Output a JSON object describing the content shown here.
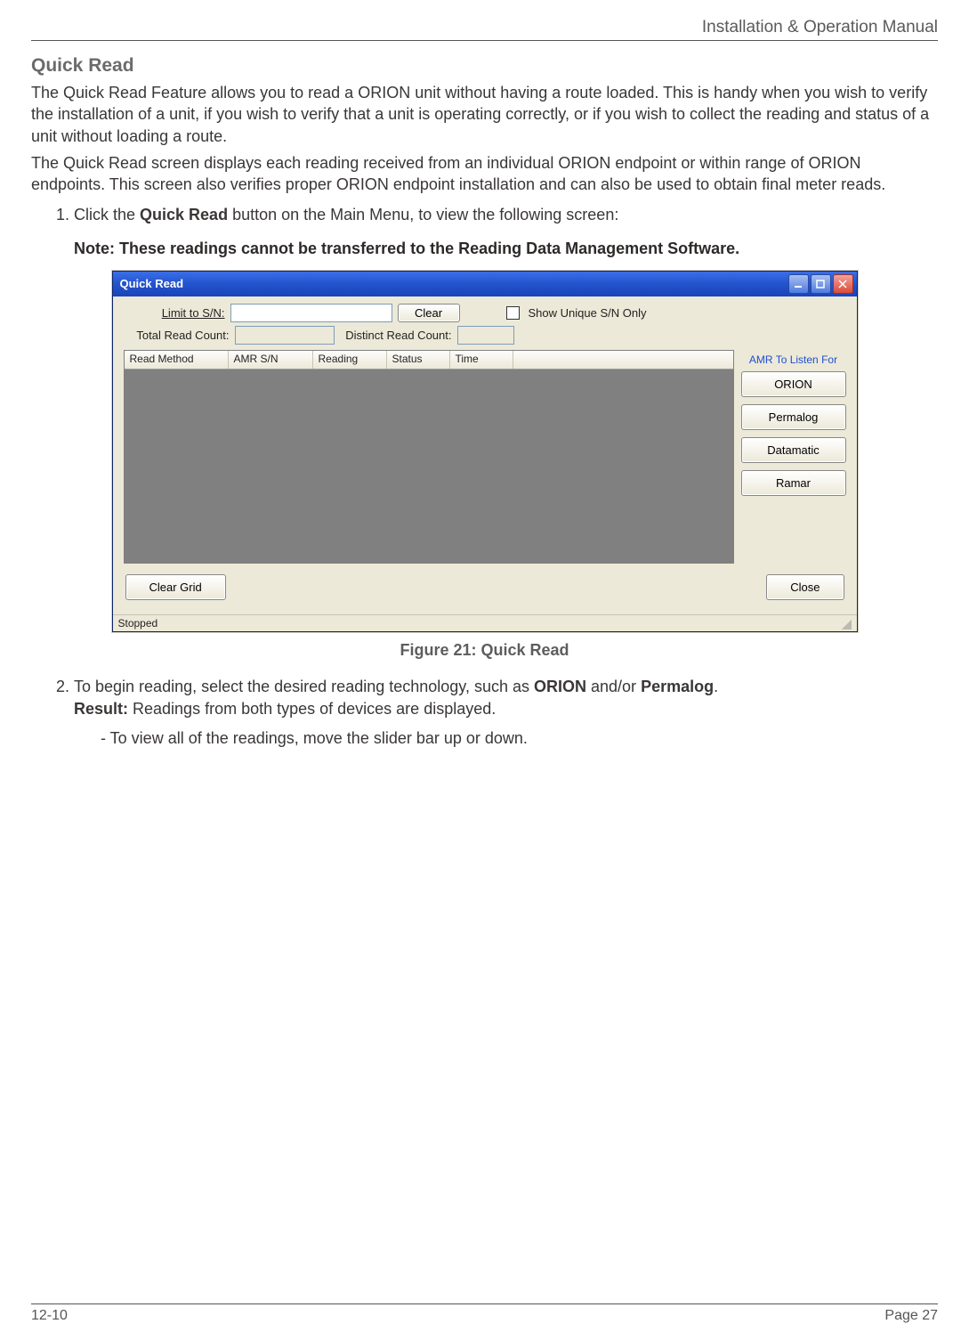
{
  "header": {
    "title": "Installation & Operation Manual"
  },
  "section": {
    "heading": "Quick Read"
  },
  "paragraphs": {
    "p1": "The Quick Read Feature allows you to read a ORION unit without having a route loaded. This is handy when you wish to verify the installation of a unit, if you wish to verify that a unit is operating correctly, or if you wish to collect the reading and status of a unit without loading a route.",
    "p2": "The Quick Read screen displays each reading received from an individual ORION endpoint or within range of ORION endpoints.  This screen also verifies proper ORION endpoint installation and can also be used to obtain final meter reads."
  },
  "steps": {
    "s1_prefix": "Click the ",
    "s1_bold": "Quick Read",
    "s1_suffix": " button on the Main Menu, to view the following screen:",
    "s2_prefix": "To begin reading, select the desired reading technology, such as ",
    "s2_b1": "ORION",
    "s2_mid": " and/or ",
    "s2_b2": "Permalog",
    "s2_suffix": ".",
    "s2_result_label": "Result:",
    "s2_result_text": " Readings from both types of devices are displayed.",
    "s2_sub": "To view all of the readings, move the slider bar up or down."
  },
  "note": "Note: These readings cannot be transferred to the Reading Data Management Software.",
  "figure": {
    "caption": "Figure 21: Quick Read"
  },
  "footer": {
    "left": "12-10",
    "right": "Page 27"
  },
  "app": {
    "title": "Quick Read",
    "limit_label": "Limit to S/N:",
    "clear_btn": "Clear",
    "show_unique": "Show Unique S/N Only",
    "total_label": "Total Read Count:",
    "distinct_label": "Distinct Read Count:",
    "columns": {
      "c1": "Read Method",
      "c2": "AMR S/N",
      "c3": "Reading",
      "c4": "Status",
      "c5": "Time"
    },
    "side_caption": "AMR To Listen For",
    "side_buttons": {
      "b1": "ORION",
      "b2": "Permalog",
      "b3": "Datamatic",
      "b4": "Ramar"
    },
    "clear_grid": "Clear Grid",
    "close": "Close",
    "status": "Stopped",
    "limit_value": "",
    "total_value": "",
    "distinct_value": ""
  }
}
